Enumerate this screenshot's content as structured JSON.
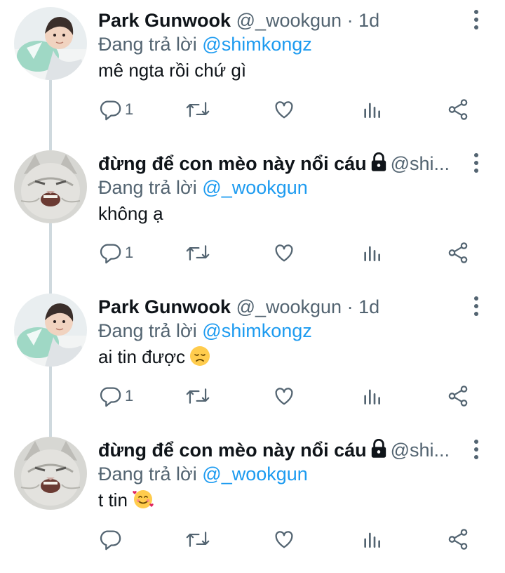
{
  "colors": {
    "link": "#1d9bf0",
    "muted": "#536471",
    "text": "#0f1419",
    "thread_line": "#cfd9de"
  },
  "tweets": [
    {
      "name": "Park Gunwook",
      "handle": "@_wookgun",
      "dot": "·",
      "time": "1d",
      "replying_prefix": "Đang trả lời",
      "replying_to": "@shimkongz",
      "text": "mê ngta rồi chứ gì",
      "reply_count": "1",
      "avatar": "person-avatar",
      "locked": false
    },
    {
      "name": "đừng để con mèo này nổi cáu",
      "handle": "@shi...",
      "dot": "",
      "time": "",
      "replying_prefix": "Đang trả lời",
      "replying_to": "@_wookgun",
      "text": "không ạ",
      "reply_count": "1",
      "avatar": "cat-avatar",
      "locked": true
    },
    {
      "name": "Park Gunwook",
      "handle": "@_wookgun",
      "dot": "·",
      "time": "1d",
      "replying_prefix": "Đang trả lời",
      "replying_to": "@shimkongz",
      "text": "ai tin được",
      "emoji": "disappointed-face",
      "reply_count": "1",
      "avatar": "person-avatar",
      "locked": false
    },
    {
      "name": "đừng để con mèo này nổi cáu",
      "handle": "@shi...",
      "dot": "",
      "time": "",
      "replying_prefix": "Đang trả lời",
      "replying_to": "@_wookgun",
      "text": "t tin",
      "emoji": "smiling-face-with-hearts",
      "reply_count": "",
      "avatar": "cat-avatar",
      "locked": true
    }
  ],
  "icons": [
    "reply-icon",
    "retweet-icon",
    "like-icon",
    "views-icon",
    "share-icon",
    "more-icon",
    "lock-icon"
  ]
}
